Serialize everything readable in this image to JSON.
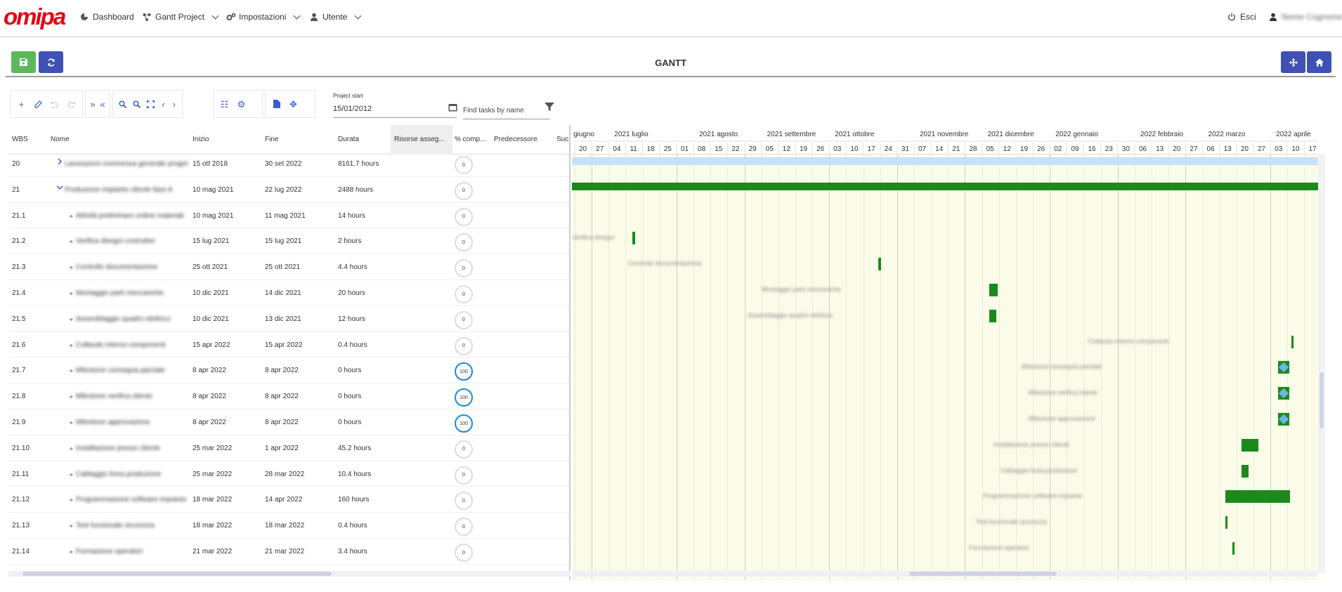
{
  "brand": {
    "logo_text": "Omipa",
    "color": "#e30613"
  },
  "nav": {
    "dashboard": "Dashboard",
    "gantt_project": "Gantt Project",
    "impostazioni": "Impostazioni",
    "utente": "Utente",
    "esci": "Esci",
    "user_name": "Nome Cognome"
  },
  "header": {
    "title": "GANTT"
  },
  "toolbar": {
    "project_start_label": "Project start",
    "project_start_value": "15/01/2012",
    "find_placeholder": "Find tasks by name"
  },
  "columns": [
    "WBS",
    "Nome",
    "Inizio",
    "Fine",
    "Durata",
    "Risorse asseg...",
    "% comp...",
    "Predecessore",
    "Suc"
  ],
  "rows": [
    {
      "wbs": "20",
      "name": "Lavorazioni commessa generale progetto",
      "start": "15 ott 2018",
      "end": "30 set 2022",
      "duration": "8161.7 hours",
      "progress": "0",
      "expander": "collapsed"
    },
    {
      "wbs": "21",
      "name": "Produzione impianto cliente fase A",
      "start": "10 mag 2021",
      "end": "22 lug 2022",
      "duration": "2488 hours",
      "progress": "0",
      "expander": "expanded"
    },
    {
      "wbs": "21.1",
      "name": "Attività preliminare ordine materiali",
      "start": "10 mag 2021",
      "end": "11 mag 2021",
      "duration": "14 hours",
      "progress": "0"
    },
    {
      "wbs": "21.2",
      "name": "Verifica disegni costruttivi",
      "start": "15 lug 2021",
      "end": "15 lug 2021",
      "duration": "2 hours",
      "progress": "0"
    },
    {
      "wbs": "21.3",
      "name": "Controllo documentazione",
      "start": "25 ott 2021",
      "end": "25 ott 2021",
      "duration": "4.4 hours",
      "progress": "0"
    },
    {
      "wbs": "21.4",
      "name": "Montaggio parti meccaniche",
      "start": "10 dic 2021",
      "end": "14 dic 2021",
      "duration": "20 hours",
      "progress": "0"
    },
    {
      "wbs": "21.5",
      "name": "Assemblaggio quadro elettrico",
      "start": "10 dic 2021",
      "end": "13 dic 2021",
      "duration": "12 hours",
      "progress": "0"
    },
    {
      "wbs": "21.6",
      "name": "Collaudo interno componenti",
      "start": "15 apr 2022",
      "end": "15 apr 2022",
      "duration": "0.4 hours",
      "progress": "0"
    },
    {
      "wbs": "21.7",
      "name": "Milestone consegna parziale",
      "start": "8 apr 2022",
      "end": "8 apr 2022",
      "duration": "0 hours",
      "progress": "100"
    },
    {
      "wbs": "21.8",
      "name": "Milestone verifica cliente",
      "start": "8 apr 2022",
      "end": "8 apr 2022",
      "duration": "0 hours",
      "progress": "100"
    },
    {
      "wbs": "21.9",
      "name": "Milestone approvazione",
      "start": "8 apr 2022",
      "end": "8 apr 2022",
      "duration": "0 hours",
      "progress": "100"
    },
    {
      "wbs": "21.10",
      "name": "Installazione presso cliente",
      "start": "25 mar 2022",
      "end": "1 apr 2022",
      "duration": "45.2 hours",
      "progress": "0"
    },
    {
      "wbs": "21.11",
      "name": "Cablaggio linea produzione",
      "start": "25 mar 2022",
      "end": "28 mar 2022",
      "duration": "10.4 hours",
      "progress": "0"
    },
    {
      "wbs": "21.12",
      "name": "Programmazione software impianto",
      "start": "18 mar 2022",
      "end": "14 apr 2022",
      "duration": "160 hours",
      "progress": "0"
    },
    {
      "wbs": "21.13",
      "name": "Test funzionale sicurezza",
      "start": "18 mar 2022",
      "end": "18 mar 2022",
      "duration": "0.4 hours",
      "progress": "0"
    },
    {
      "wbs": "21.14",
      "name": "Formazione operatori",
      "start": "21 mar 2022",
      "end": "21 mar 2022",
      "duration": "3.4 hours",
      "progress": "0"
    }
  ],
  "timeline": {
    "months": [
      "giugno",
      "2021 luglio",
      "2021 agosto",
      "2021 settembre",
      "2021 ottobre",
      "2021 novembre",
      "2021 dicembre",
      "2022 gennaio",
      "2022 febbraio",
      "2022 marzo",
      "2022 aprile"
    ],
    "weeks": [
      "20",
      "27",
      "04",
      "11",
      "18",
      "25",
      "01",
      "08",
      "15",
      "22",
      "29",
      "05",
      "12",
      "19",
      "26",
      "03",
      "10",
      "17",
      "24",
      "31",
      "07",
      "14",
      "21",
      "28",
      "05",
      "12",
      "19",
      "26",
      "02",
      "09",
      "16",
      "23",
      "30",
      "06",
      "13",
      "20",
      "27",
      "06",
      "13",
      "20",
      "27",
      "03",
      "10",
      "17"
    ]
  },
  "colors": {
    "bar_green": "#1b8a1b",
    "summary_blue": "#c4e3f7",
    "milestone": "#6ab7e8",
    "accent_blue": "#3f51b5",
    "save_green": "#5cb85c"
  }
}
